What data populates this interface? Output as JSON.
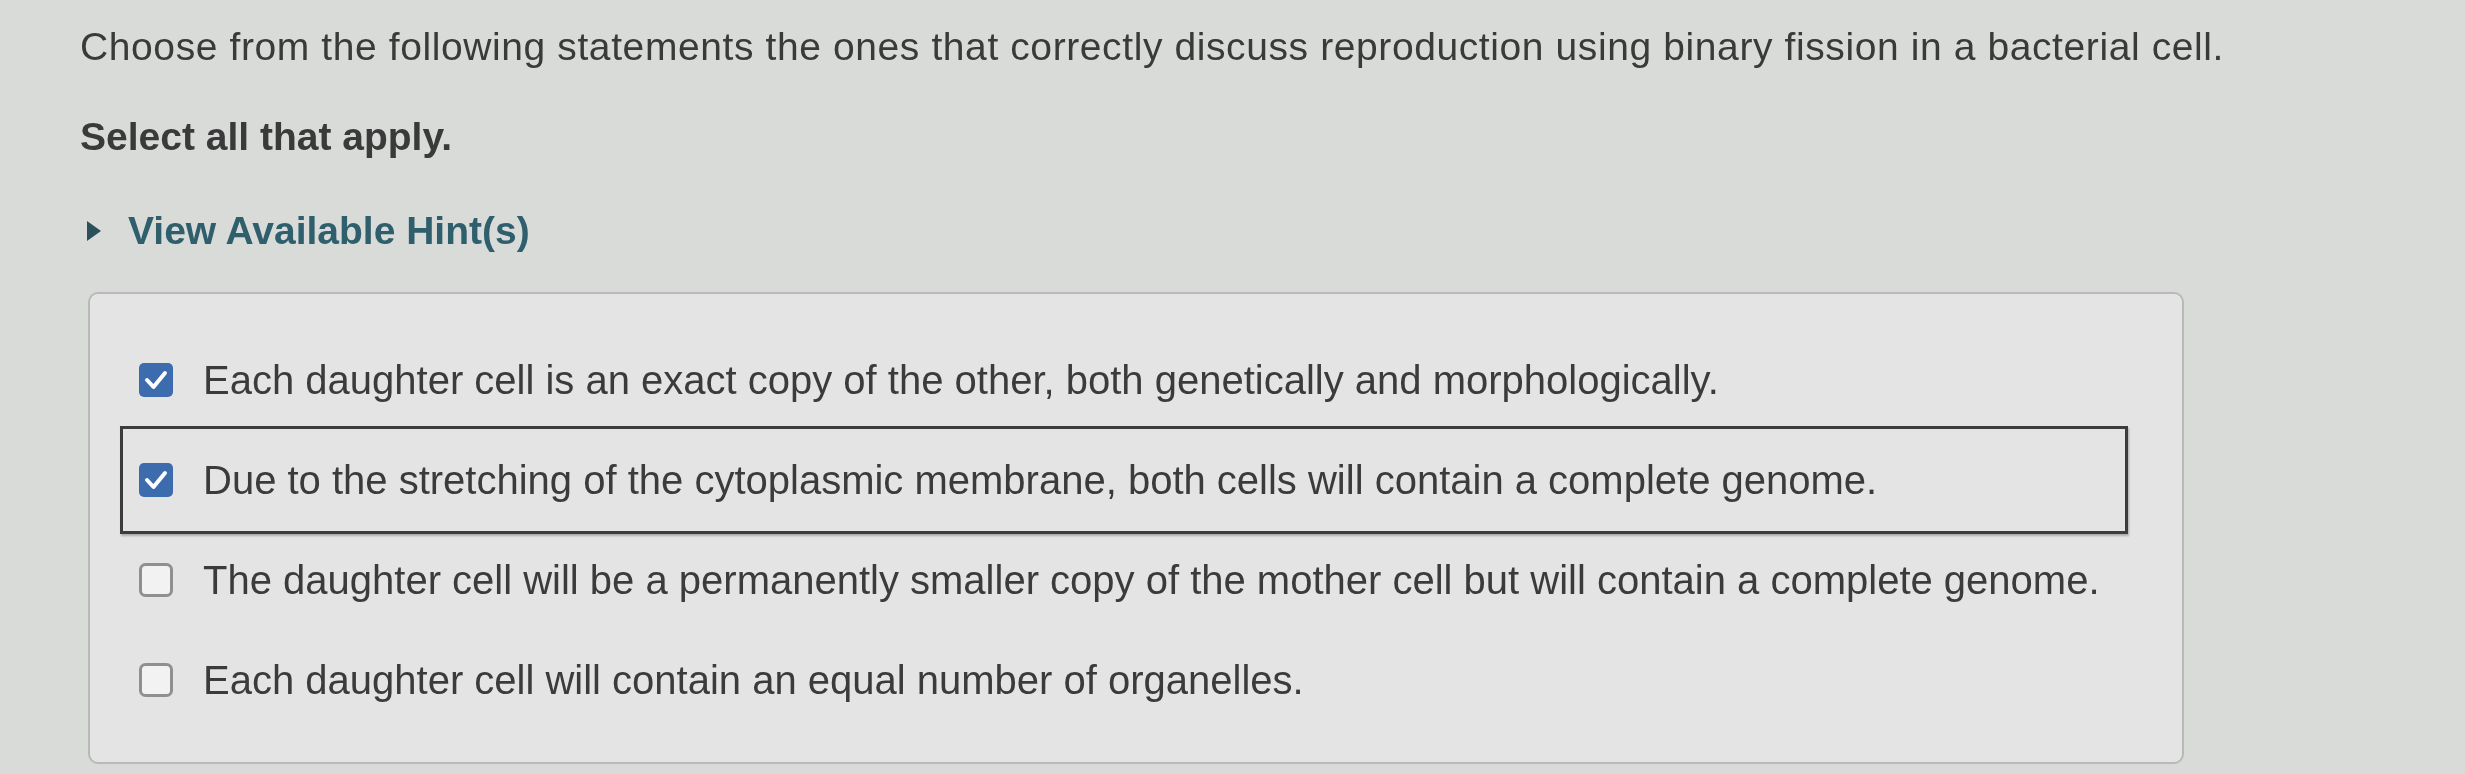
{
  "question": {
    "text": "Choose from the following statements the ones that correctly discuss reproduction using binary fission in a bacterial cell.",
    "instruction": "Select all that apply."
  },
  "hint": {
    "label": "View Available Hint(s)",
    "expanded": false
  },
  "options": [
    {
      "text": "Each daughter cell is an exact copy of the other, both genetically and morphologically.",
      "checked": true,
      "focused": false
    },
    {
      "text": "Due to the stretching of the cytoplasmic membrane, both cells will contain a complete genome.",
      "checked": true,
      "focused": true
    },
    {
      "text": "The daughter cell will be a permanently smaller copy of the mother cell but will contain a complete genome.",
      "checked": false,
      "focused": false
    },
    {
      "text": "Each daughter cell will contain an equal number of organelles.",
      "checked": false,
      "focused": false
    }
  ]
}
